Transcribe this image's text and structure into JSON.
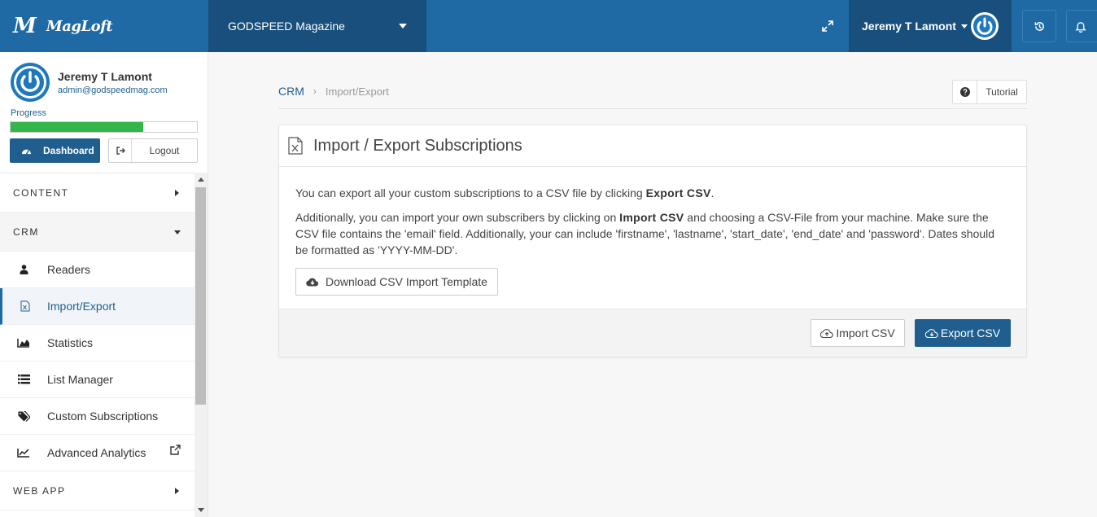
{
  "colors": {
    "topbar": "#1f6aa5",
    "topbar_dark": "#184f7c",
    "primary": "#1f5e8e",
    "progress": "#34b64a"
  },
  "brand": {
    "name": "MagLoft",
    "logo_icon": "maglft-logo-icon"
  },
  "header": {
    "magazine": "GODSPEED Magazine",
    "user_name": "Jeremy T Lamont",
    "icons": [
      "expand-icon",
      "history-icon",
      "bell-icon"
    ]
  },
  "profile": {
    "name": "Jeremy T Lamont",
    "email": "admin@godspeedmag.com",
    "progress_label": "Progress",
    "progress_fraction": 0.71,
    "dashboard_label": "Dashboard",
    "logout_label": "Logout"
  },
  "nav": {
    "content": "CONTENT",
    "crm": "CRM",
    "items": [
      {
        "label": "Readers",
        "icon": "user-icon"
      },
      {
        "label": "Import/Export",
        "icon": "excel-file-icon"
      },
      {
        "label": "Statistics",
        "icon": "area-chart-icon"
      },
      {
        "label": "List Manager",
        "icon": "list-icon"
      },
      {
        "label": "Custom Subscriptions",
        "icon": "tags-icon"
      },
      {
        "label": "Advanced Analytics",
        "icon": "line-chart-icon"
      }
    ],
    "web_app": "WEB APP"
  },
  "breadcrumb": {
    "root": "CRM",
    "current": "Import/Export"
  },
  "tutorial_label": "Tutorial",
  "panel": {
    "title": "Import / Export Subscriptions",
    "p1_before": "You can export all your custom subscriptions to a CSV file by clicking ",
    "p1_bold": "Export CSV",
    "p1_after": ".",
    "p2_before": "Additionally, you can import your own subscribers by clicking on ",
    "p2_bold": "Import CSV",
    "p2_after": " and choosing a CSV-File from your machine. Make sure the CSV file contains the 'email' field. Additionally, your can include 'firstname', 'lastname', 'start_date', 'end_date' and 'password'. Dates should be formatted as 'YYYY-MM-DD'.",
    "download_label": "Download CSV Import Template",
    "import_label": "Import CSV",
    "export_label": "Export CSV"
  }
}
